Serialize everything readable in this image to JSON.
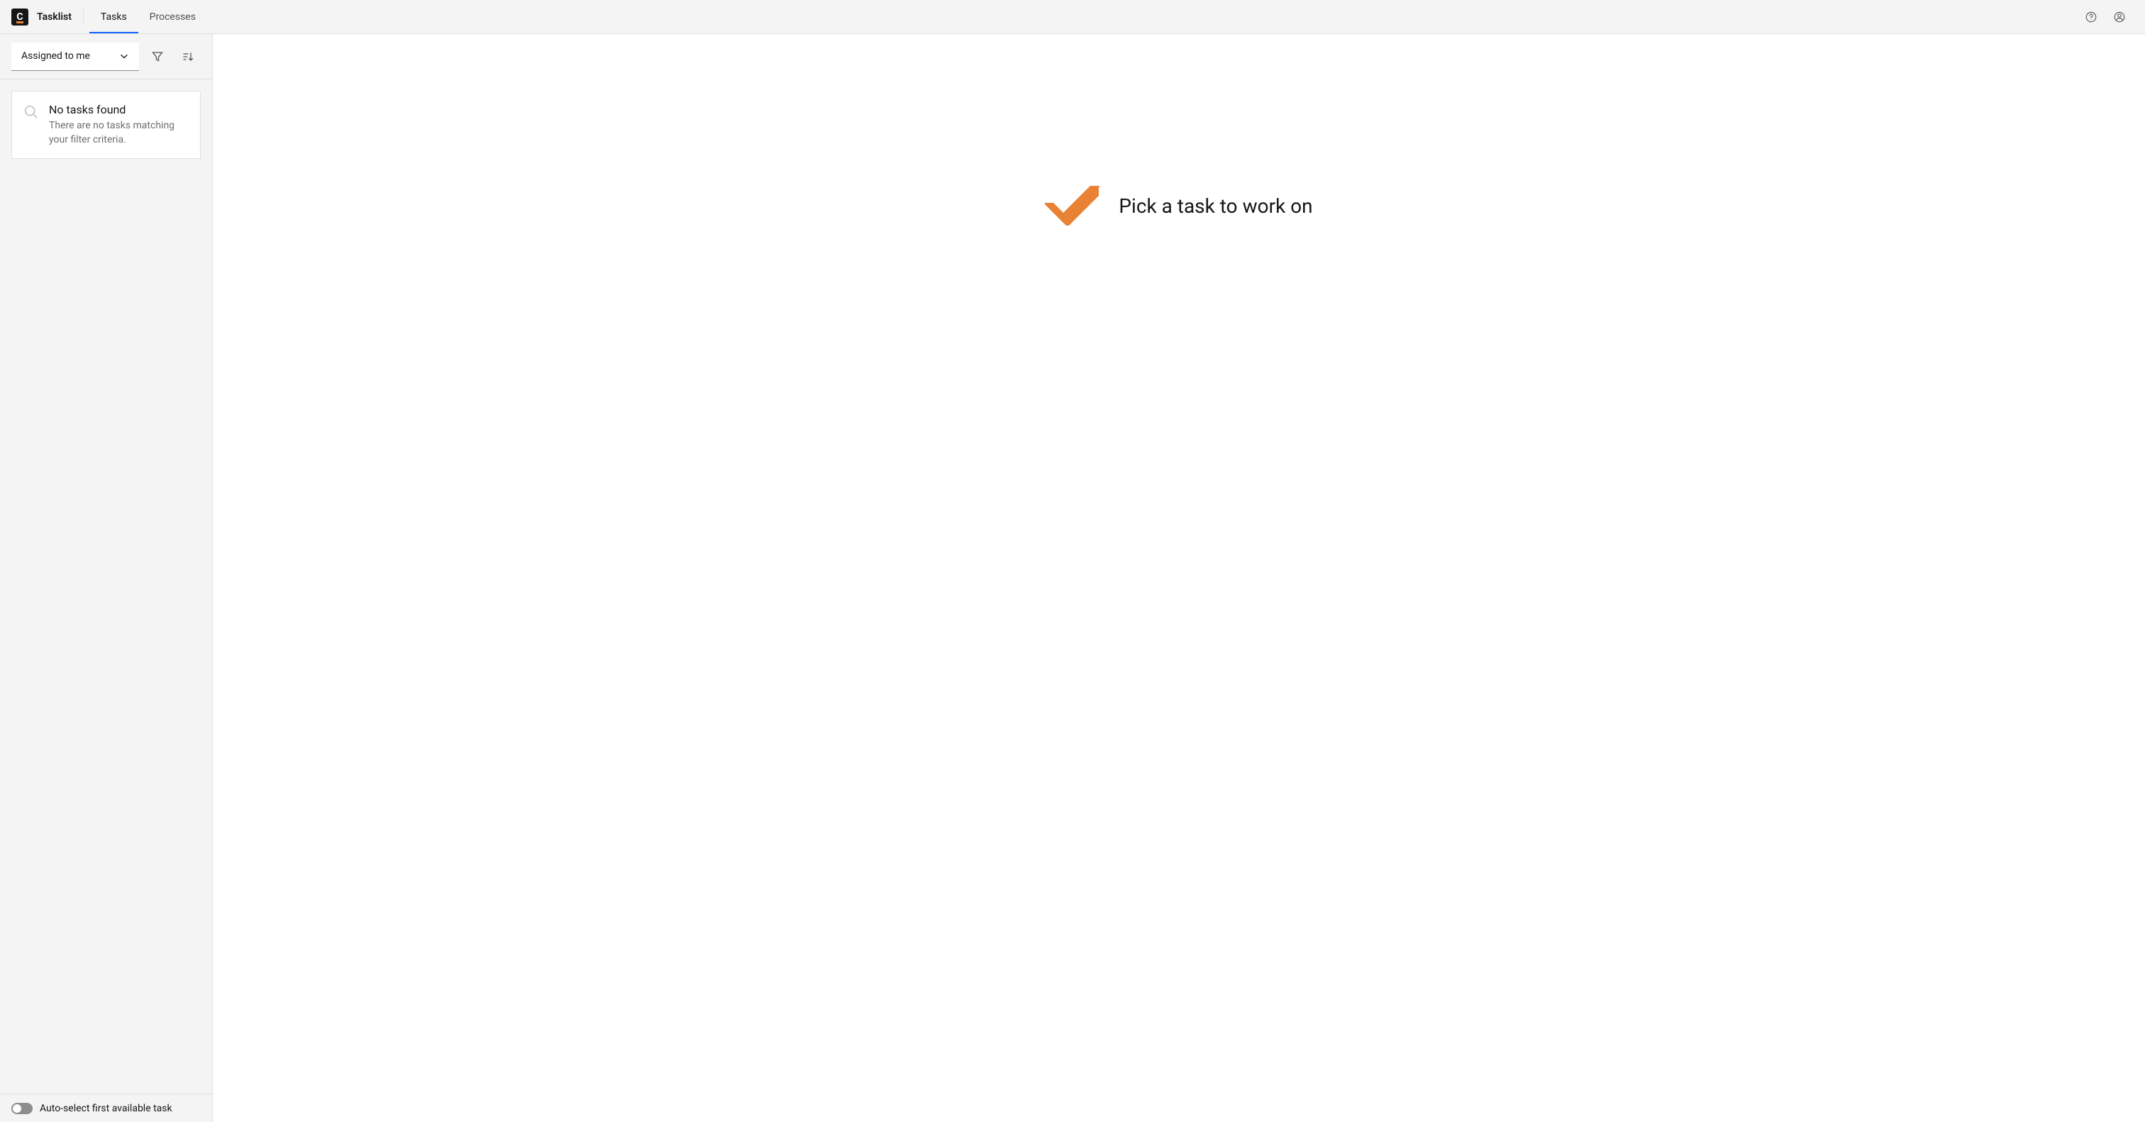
{
  "header": {
    "app_name": "Tasklist",
    "nav": [
      {
        "label": "Tasks",
        "active": true
      },
      {
        "label": "Processes",
        "active": false
      }
    ]
  },
  "sidebar": {
    "filter_dropdown": {
      "selected": "Assigned to me"
    },
    "empty": {
      "title": "No tasks found",
      "description": "There are no tasks matching your filter criteria."
    },
    "footer": {
      "auto_select_label": "Auto-select first available task",
      "auto_select_on": false
    }
  },
  "main": {
    "empty_state": "Pick a task to work on"
  },
  "colors": {
    "accent_orange": "#e98234",
    "accent_blue": "#0f62fe"
  }
}
